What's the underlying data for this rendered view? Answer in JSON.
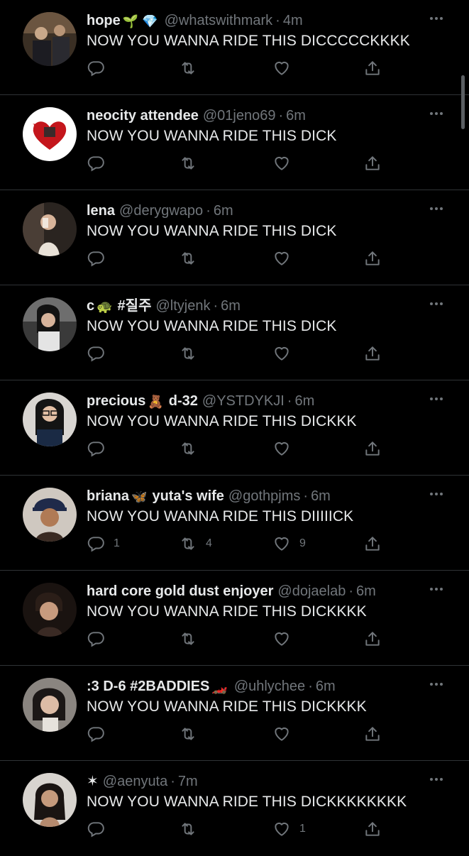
{
  "colors": {
    "background": "#000000",
    "text_primary": "#e7e9ea",
    "text_secondary": "#71767b",
    "divider": "#2f3336"
  },
  "icons": {
    "reply": "reply-icon",
    "retweet": "retweet-icon",
    "like": "heart-icon",
    "share": "share-icon",
    "more": "more-icon"
  },
  "tweets": [
    {
      "name": "hope",
      "emoji": "🌱 💎",
      "handle": "@whatswithmark",
      "sep": "·",
      "time": "4m",
      "text": "NOW YOU WANNA RIDE THIS DICCCCCKKKK",
      "replies": "",
      "retweets": "",
      "likes": ""
    },
    {
      "name": "neocity attendee",
      "emoji": "",
      "handle": "@01jeno69",
      "sep": "·",
      "time": "6m",
      "text": "NOW YOU WANNA RIDE THIS DICK",
      "replies": "",
      "retweets": "",
      "likes": ""
    },
    {
      "name": "lena",
      "emoji": "",
      "handle": "@derygwapo",
      "sep": "·",
      "time": "6m",
      "text": "NOW YOU WANNA RIDE THIS DICK",
      "replies": "",
      "retweets": "",
      "likes": ""
    },
    {
      "name": "c",
      "emoji": "🐢",
      "name2": "#질주",
      "handle": "@ltyjenk",
      "sep": "·",
      "time": "6m",
      "text": "NOW YOU WANNA RIDE THIS DICK",
      "replies": "",
      "retweets": "",
      "likes": ""
    },
    {
      "name": "precious",
      "emoji": "🧸",
      "name2": "d-32",
      "handle": "@YSTDYKJI",
      "sep": "·",
      "time": "6m",
      "text": "NOW YOU WANNA RIDE THIS DICKKK",
      "replies": "",
      "retweets": "",
      "likes": ""
    },
    {
      "name": "briana",
      "emoji": "🦋",
      "name2": "yuta's wife",
      "handle": "@gothpjms",
      "sep": "·",
      "time": "6m",
      "text": "NOW YOU WANNA RIDE THIS DIIIIICK",
      "replies": "1",
      "retweets": "4",
      "likes": "9"
    },
    {
      "name": "hard core gold dust enjoyer",
      "emoji": "",
      "handle": "@dojaelab",
      "sep": "·",
      "time": "6m",
      "text": "NOW YOU WANNA RIDE THIS DICKKKK",
      "replies": "",
      "retweets": "",
      "likes": ""
    },
    {
      "name": ":3 D-6 #2BADDIES",
      "emoji": "🏎️",
      "handle": "@uhlychee",
      "sep": "·",
      "time": "6m",
      "text": "NOW YOU WANNA RIDE THIS DICKKKK",
      "replies": "",
      "retweets": "",
      "likes": ""
    },
    {
      "name": "✶",
      "emoji": "",
      "handle": "@aenyuta",
      "sep": "·",
      "time": "7m",
      "text": "NOW YOU WANNA RIDE THIS DICKKKKKKKK",
      "replies": "",
      "retweets": "",
      "likes": "1"
    }
  ]
}
